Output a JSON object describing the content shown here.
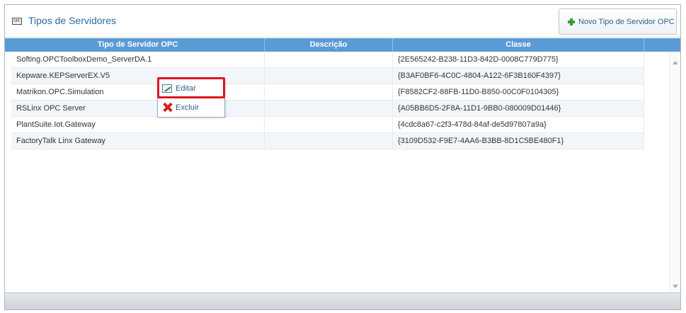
{
  "header": {
    "icon": "opc-icon",
    "icon_text": "OPC",
    "title": "Tipos de Servidores",
    "new_button_label": "Novo Tipo de Servidor OPC",
    "new_button_icon": "plus-icon"
  },
  "grid": {
    "columns": [
      "Tipo de Servidor OPC",
      "Descrição",
      "Classe"
    ],
    "rows": [
      {
        "tipo": "Softing.OPCToolboxDemo_ServerDA.1",
        "descricao": "",
        "classe": "{2E565242-B238-11D3-842D-0008C779D775}"
      },
      {
        "tipo": "Kepware.KEPServerEX.V5",
        "descricao": "",
        "classe": "{B3AF0BF6-4C0C-4804-A122-6F3B160F4397}"
      },
      {
        "tipo": "Matrikon.OPC.Simulation",
        "descricao": "",
        "classe": "{F8582CF2-88FB-11D0-B850-00C0F0104305}"
      },
      {
        "tipo": "RSLinx OPC Server",
        "descricao": "",
        "classe": "{A05BB6D5-2F8A-11D1-9BB0-080009D01446}"
      },
      {
        "tipo": "PlantSuite.Iot.Gateway",
        "descricao": "",
        "classe": "{4cdc8a67-c2f3-478d-84af-de5d97807a9a}"
      },
      {
        "tipo": "FactoryTalk Linx Gateway",
        "descricao": "",
        "classe": "{3109D532-F9E7-4AA6-B3BB-8D1C5BE480F1}"
      }
    ]
  },
  "context_menu": {
    "edit_label": "Editar",
    "edit_icon": "edit-icon",
    "delete_label": "Excluir",
    "delete_icon": "delete-icon"
  },
  "colors": {
    "header_bar": "#5b9bd5",
    "title": "#2c6ca3",
    "highlight": "#e0141e",
    "plus": "#3a9a33",
    "delete": "#d3201f"
  }
}
